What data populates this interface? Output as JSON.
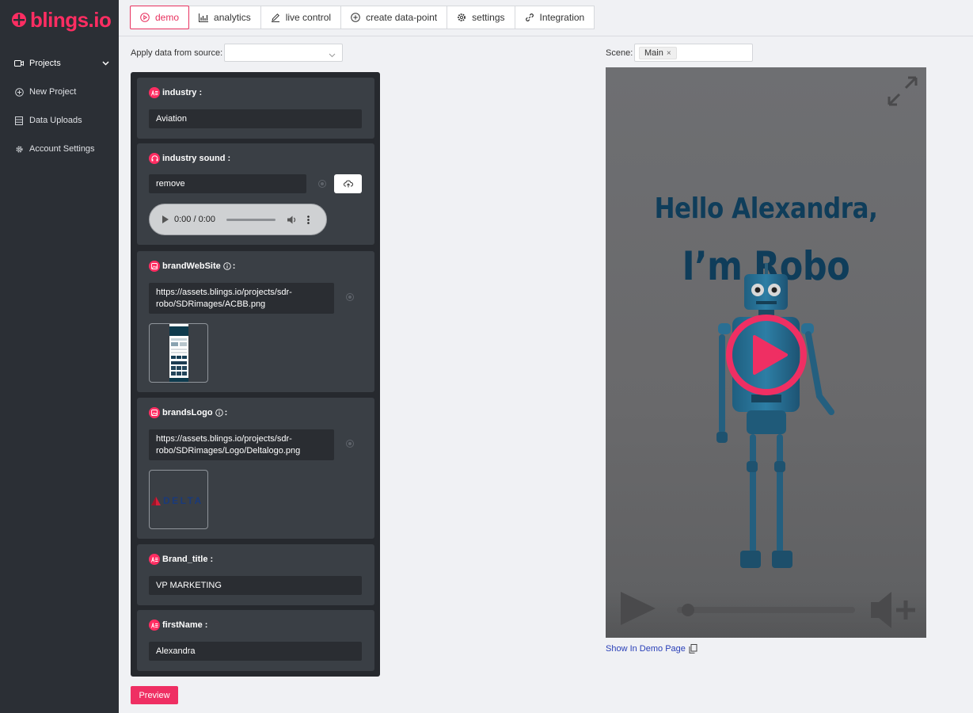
{
  "brand": {
    "logo_text": "blings.io",
    "accent": "#ff2d62"
  },
  "sidebar": {
    "items": [
      {
        "label": "Projects",
        "icon": "video-icon",
        "active": true
      },
      {
        "label": "New Project",
        "icon": "plus-circle-icon"
      },
      {
        "label": "Data Uploads",
        "icon": "data-table-icon"
      },
      {
        "label": "Account Settings",
        "icon": "gear-icon"
      }
    ]
  },
  "tabs": [
    {
      "label": "demo",
      "icon": "play-circle-icon",
      "active": true
    },
    {
      "label": "analytics",
      "icon": "bar-chart-icon"
    },
    {
      "label": "live control",
      "icon": "pencil-icon"
    },
    {
      "label": "create data-point",
      "icon": "plus-circle-icon"
    },
    {
      "label": "settings",
      "icon": "gear-icon"
    },
    {
      "label": "Integration",
      "icon": "link-icon"
    }
  ],
  "apply": {
    "label": "Apply data from source:",
    "value": ""
  },
  "fields": {
    "industry": {
      "label": "industry :",
      "value": "Aviation"
    },
    "industry_sound": {
      "label": "industry sound :",
      "value": "remove",
      "audio_time": "0:00 / 0:00"
    },
    "brand_website": {
      "label": "brandWebSite",
      "suffix": ":",
      "value_line1": "https://assets.blings.io/projects/sdr-",
      "value_line2": "robo/SDRimages/ACBB.png"
    },
    "brands_logo": {
      "label": "brandsLogo",
      "suffix": ":",
      "value_line1": "https://assets.blings.io/projects/sdr-",
      "value_line2": "robo/SDRimages/Logo/Deltalogo.png",
      "logo_text": "DELTA"
    },
    "brand_title": {
      "label": "Brand_title :",
      "value": "VP MARKETING"
    },
    "first_name": {
      "label": "firstName :",
      "value": "Alexandra"
    }
  },
  "preview_label": "Preview",
  "scene": {
    "label": "Scene:",
    "chip": "Main",
    "chip_remove": "×"
  },
  "video": {
    "line1": "Hello Alexandra,",
    "line2": "I’m Robo",
    "progress": 0.03
  },
  "demo_link": "Show In Demo Page"
}
